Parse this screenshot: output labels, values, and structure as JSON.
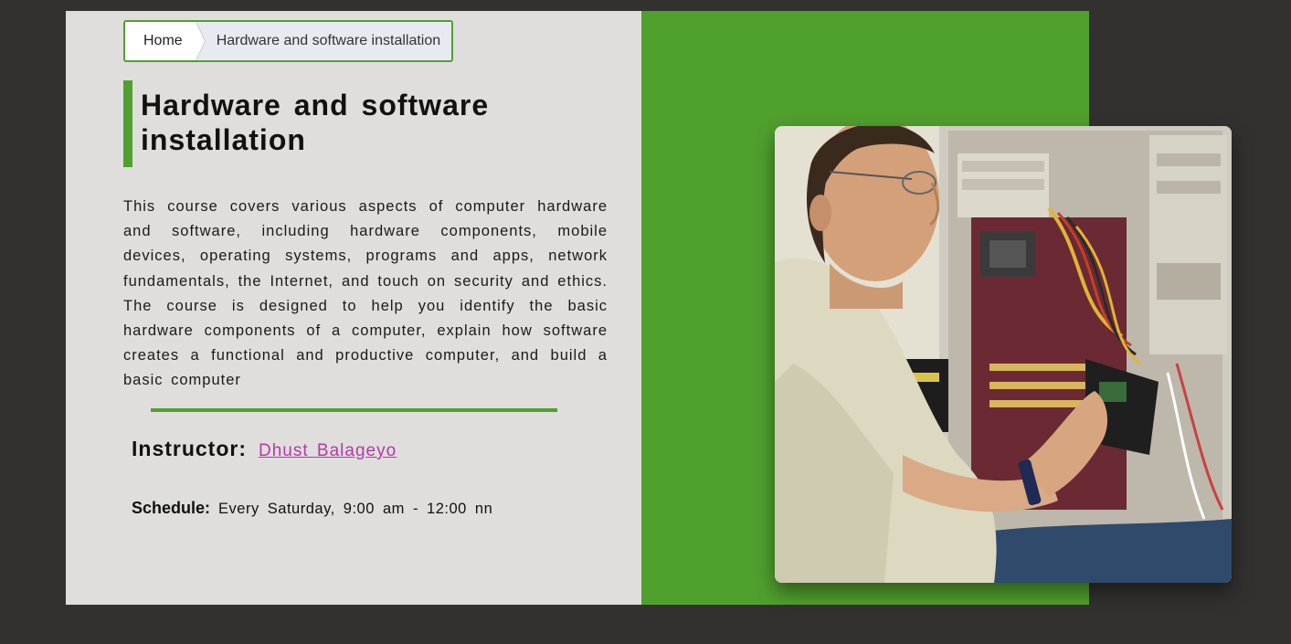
{
  "breadcrumb": {
    "home": "Home",
    "current": "Hardware and software installation"
  },
  "course": {
    "title": "Hardware and software installation",
    "description": "This course covers various aspects of computer hardware and software, including hardware components, mobile devices, operating systems, programs and apps, network fundamentals, the Internet, and touch on security and ethics. The course is designed to help you identify the basic hardware components of a computer, explain how software creates a functional and productive computer, and build a basic computer",
    "instructor_label": "Instructor:",
    "instructor_name": "Dhust Balageyo",
    "schedule_label": "Schedule:",
    "schedule_value": "Every Saturday, 9:00 am - 12:00 nn"
  },
  "image": {
    "subject": "technician-repairing-computer-photo"
  },
  "colors": {
    "accent_green": "#50a02e",
    "page_background": "#323130",
    "panel_background": "#dfdedd",
    "link_color": "#b33aa6"
  }
}
